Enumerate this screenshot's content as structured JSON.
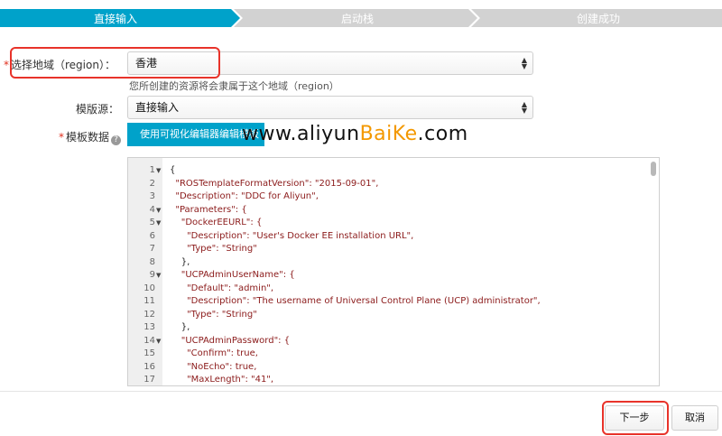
{
  "steps": [
    {
      "label": "直接输入",
      "state": "active"
    },
    {
      "label": "启动栈",
      "state": "inactive"
    },
    {
      "label": "创建成功",
      "state": "inactive"
    }
  ],
  "colors": {
    "active": "#00a2ca",
    "inactive": "#d2d2d2",
    "highlight": "#e8332a",
    "watermark_accent": "#f39800"
  },
  "form": {
    "region": {
      "label": "选择地域（region）：",
      "value": "香港",
      "help": "您所创建的资源将会隶属于这个地域（region）"
    },
    "template_source": {
      "label": "模版源：",
      "value": "直接输入"
    },
    "template_data": {
      "label": "模板数据",
      "editor_button": "使用可视化编辑器编辑模板"
    }
  },
  "watermark": {
    "prefix": "www.aliyun",
    "accent": "BaiKe",
    "suffix": ".com"
  },
  "code": {
    "lines": [
      {
        "n": "1",
        "fold": true,
        "text": "{"
      },
      {
        "n": "2",
        "fold": false,
        "text": "  \"ROSTemplateFormatVersion\": \"2015-09-01\","
      },
      {
        "n": "3",
        "fold": false,
        "text": "  \"Description\": \"DDC for Aliyun\","
      },
      {
        "n": "4",
        "fold": true,
        "text": "  \"Parameters\": {"
      },
      {
        "n": "5",
        "fold": true,
        "text": "    \"DockerEEURL\": {"
      },
      {
        "n": "6",
        "fold": false,
        "text": "      \"Description\": \"User's Docker EE installation URL\","
      },
      {
        "n": "7",
        "fold": false,
        "text": "      \"Type\": \"String\""
      },
      {
        "n": "8",
        "fold": false,
        "text": "    },"
      },
      {
        "n": "9",
        "fold": true,
        "text": "    \"UCPAdminUserName\": {"
      },
      {
        "n": "10",
        "fold": false,
        "text": "      \"Default\": \"admin\","
      },
      {
        "n": "11",
        "fold": false,
        "text": "      \"Description\": \"The username of Universal Control Plane (UCP) administrator\","
      },
      {
        "n": "12",
        "fold": false,
        "text": "      \"Type\": \"String\""
      },
      {
        "n": "13",
        "fold": false,
        "text": "    },"
      },
      {
        "n": "14",
        "fold": true,
        "text": "    \"UCPAdminPassword\": {"
      },
      {
        "n": "15",
        "fold": false,
        "text": "      \"Confirm\": true,"
      },
      {
        "n": "16",
        "fold": false,
        "text": "      \"NoEcho\": true,"
      },
      {
        "n": "17",
        "fold": false,
        "text": "      \"MaxLength\": \"41\","
      }
    ]
  },
  "footer": {
    "next": "下一步",
    "cancel": "取消"
  }
}
